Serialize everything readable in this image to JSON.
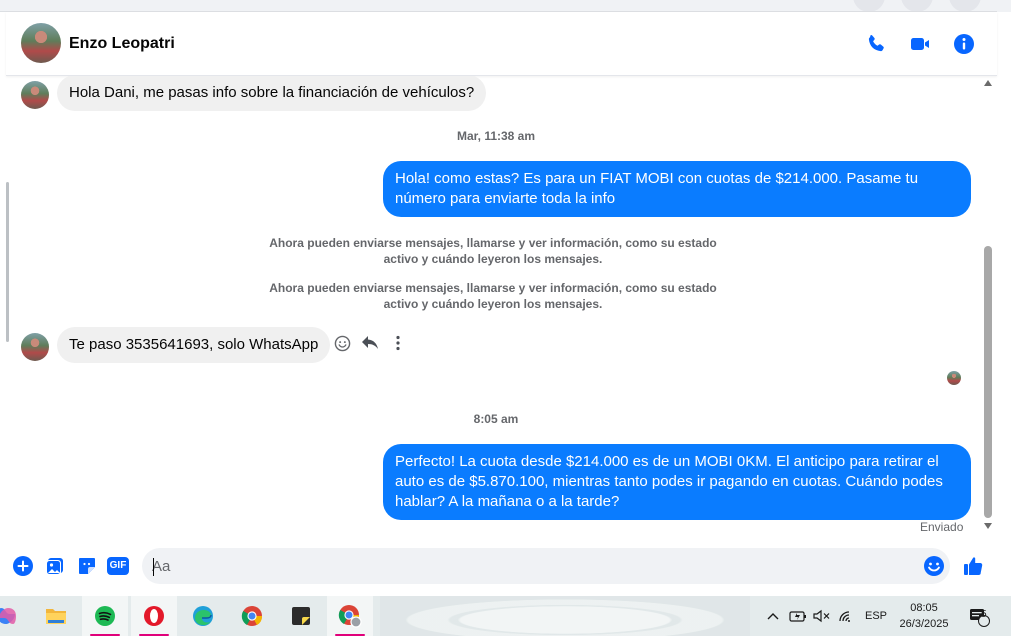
{
  "header": {
    "contact_name": "Enzo Leopatri"
  },
  "messages": {
    "msg1": "Hola Dani, me pasas info sobre la financiación de vehículos?",
    "ts1": "Mar, 11:38 am",
    "msg2": "Hola! como estas? Es para un FIAT MOBI con cuotas de $214.000. Pasame tu número para enviarte toda la info",
    "sys1_line1": "Ahora pueden enviarse mensajes, llamarse y ver información, como su estado",
    "sys1_line2": "activo y cuándo leyeron los mensajes.",
    "sys2_line1": "Ahora pueden enviarse mensajes, llamarse y ver información, como su estado",
    "sys2_line2": "activo y cuándo leyeron los mensajes.",
    "msg3": "Te paso 3535641693, solo WhatsApp",
    "ts2": "8:05 am",
    "msg4": "Perfecto! La cuota desde $214.000 es de un MOBI 0KM. El anticipo para retirar el auto es de $5.870.100, mientras tanto podes ir pagando en cuotas. Cuándo podes hablar? A la mañana o a la tarde?",
    "status": "Enviado"
  },
  "composer": {
    "placeholder": "Aa",
    "gif_label": "GIF"
  },
  "taskbar": {
    "language": "ESP",
    "time": "08:05",
    "date": "26/3/2025",
    "notification_count": "5"
  },
  "colors": {
    "accent": "#0a7cff",
    "icon_blue": "#0866ff"
  }
}
